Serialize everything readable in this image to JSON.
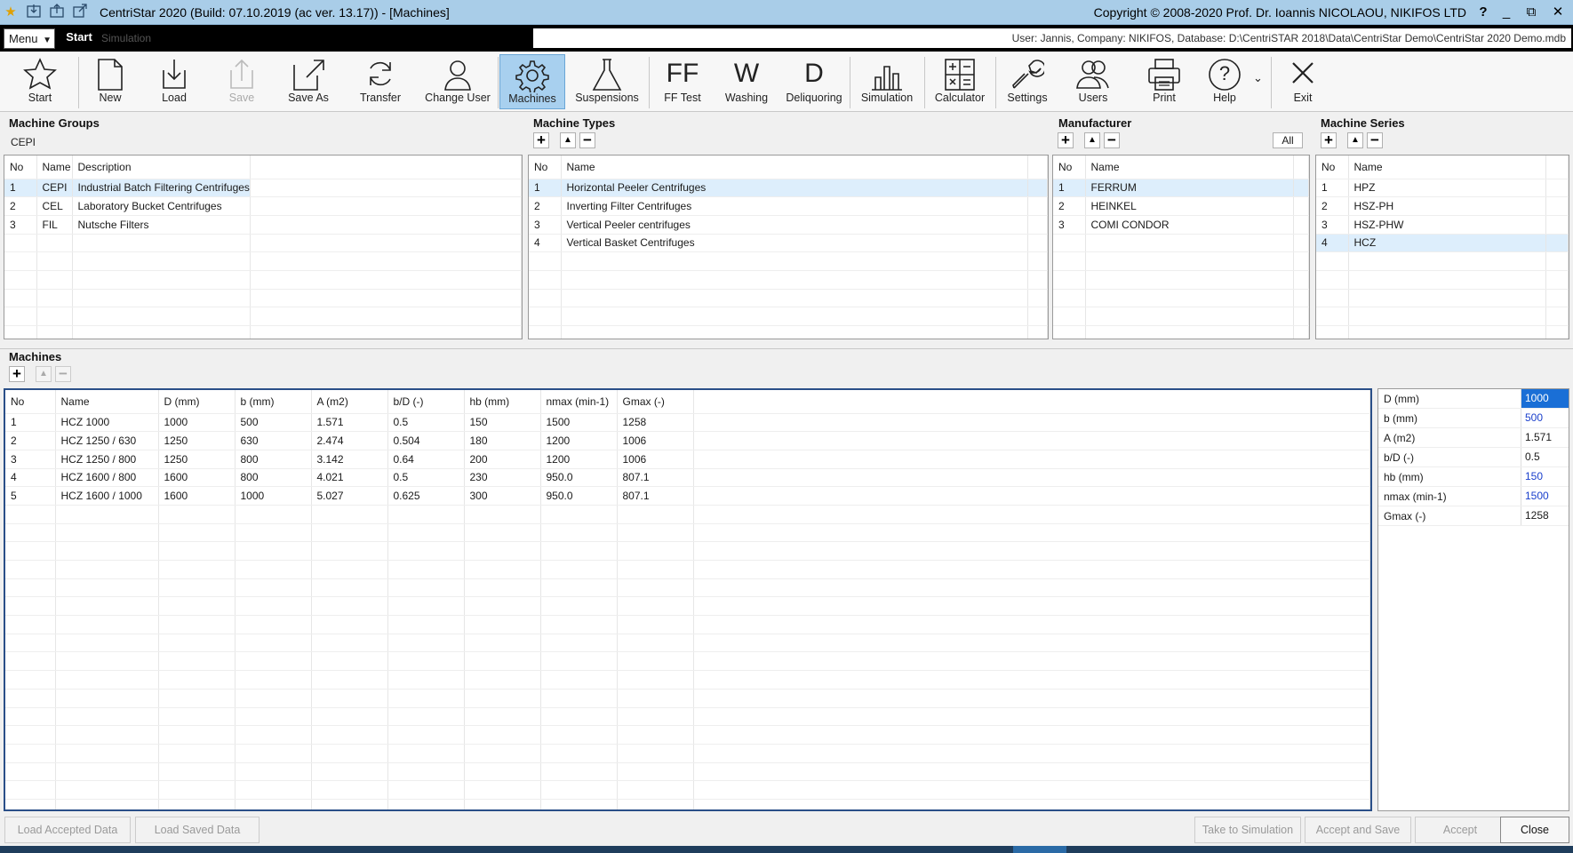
{
  "window": {
    "title": "CentriStar 2020 (Build: 07.10.2019 (ac ver. 13.17)) - [Machines]",
    "copyright": "Copyright © 2008-2020 Prof. Dr. Ioannis NICOLAOU, NIKIFOS LTD",
    "help_btn": "?",
    "minimize_btn": "_",
    "restore_btn": "⧉",
    "close_btn": "✕"
  },
  "menubar": {
    "menu_label": "Menu",
    "tabs": [
      {
        "label": "Start"
      },
      {
        "label": "Simulation"
      }
    ],
    "user_info": "User: Jannis, Company: NIKIFOS, Database: D:\\CentriSTAR 2018\\Data\\CentriStar  Demo\\CentriStar 2020  Demo.mdb"
  },
  "toolbar": {
    "items": [
      {
        "label": "Start"
      },
      {
        "label": "New"
      },
      {
        "label": "Load"
      },
      {
        "label": "Save"
      },
      {
        "label": "Save As"
      },
      {
        "label": "Transfer"
      },
      {
        "label": "Change User"
      },
      {
        "label": "Machines"
      },
      {
        "label": "Suspensions"
      },
      {
        "label": "FF Test",
        "glyph": "FF"
      },
      {
        "label": "Washing",
        "glyph": "W"
      },
      {
        "label": "Deliquoring",
        "glyph": "D"
      },
      {
        "label": "Simulation"
      },
      {
        "label": "Calculator"
      },
      {
        "label": "Settings"
      },
      {
        "label": "Users"
      },
      {
        "label": "Print"
      },
      {
        "label": "Help",
        "glyph": "?"
      },
      {
        "label": "Exit"
      }
    ]
  },
  "machine_groups": {
    "title": "Machine Groups",
    "selected": "CEPI",
    "headers": [
      "No",
      "Name",
      "Description"
    ],
    "rows": [
      [
        "1",
        "CEPI",
        "Industrial Batch Filtering Centrifuges"
      ],
      [
        "2",
        "CEL",
        "Laboratory Bucket Centrifuges"
      ],
      [
        "3",
        "FIL",
        "Nutsche Filters"
      ]
    ]
  },
  "machine_types": {
    "title": "Machine Types",
    "headers": [
      "No",
      "Name"
    ],
    "rows": [
      [
        "1",
        "Horizontal Peeler Centrifuges"
      ],
      [
        "2",
        "Inverting Filter Centrifuges"
      ],
      [
        "3",
        "Vertical Peeler centrifuges"
      ],
      [
        "4",
        "Vertical Basket Centrifuges"
      ]
    ]
  },
  "manufacturer": {
    "title": "Manufacturer",
    "all_label": "All",
    "headers": [
      "No",
      "Name"
    ],
    "rows": [
      [
        "1",
        "FERRUM"
      ],
      [
        "2",
        "HEINKEL"
      ],
      [
        "3",
        "COMI CONDOR"
      ]
    ]
  },
  "machine_series": {
    "title": "Machine Series",
    "headers": [
      "No",
      "Name"
    ],
    "rows": [
      [
        "1",
        "HPZ"
      ],
      [
        "2",
        "HSZ-PH"
      ],
      [
        "3",
        "HSZ-PHW"
      ],
      [
        "4",
        "HCZ"
      ]
    ]
  },
  "machines": {
    "title": "Machines",
    "headers": [
      "No",
      "Name",
      "D (mm)",
      "b (mm)",
      "A (m2)",
      "b/D (-)",
      "hb (mm)",
      "nmax (min-1)",
      "Gmax (-)"
    ],
    "rows": [
      [
        "1",
        "HCZ 1000",
        "1000",
        "500",
        "1.571",
        "0.5",
        "150",
        "1500",
        "1258"
      ],
      [
        "2",
        "HCZ 1250 / 630",
        "1250",
        "630",
        "2.474",
        "0.504",
        "180",
        "1200",
        "1006"
      ],
      [
        "3",
        "HCZ 1250 / 800",
        "1250",
        "800",
        "3.142",
        "0.64",
        "200",
        "1200",
        "1006"
      ],
      [
        "4",
        "HCZ 1600 / 800",
        "1600",
        "800",
        "4.021",
        "0.5",
        "230",
        "950.0",
        "807.1"
      ],
      [
        "5",
        "HCZ 1600 / 1000",
        "1600",
        "1000",
        "5.027",
        "0.625",
        "300",
        "950.0",
        "807.1"
      ]
    ]
  },
  "properties": [
    {
      "name": "D (mm)",
      "value": "1000"
    },
    {
      "name": "b (mm)",
      "value": "500"
    },
    {
      "name": "A (m2)",
      "value": "1.571"
    },
    {
      "name": "b/D (-)",
      "value": "0.5"
    },
    {
      "name": "hb (mm)",
      "value": "150"
    },
    {
      "name": "nmax (min-1)",
      "value": "1500"
    },
    {
      "name": "Gmax (-)",
      "value": "1258"
    }
  ],
  "buttons": {
    "load_accepted": "Load Accepted Data",
    "load_saved": "Load Saved Data",
    "take_to_sim": "Take to Simulation",
    "accept_save": "Accept and Save",
    "accept": "Accept",
    "close": "Close"
  },
  "colors": {
    "accent": "#1a6fd6",
    "selected_row": "#ddeefc",
    "active_tool": "#a8d0ef",
    "titlebar": "#a9cde8"
  }
}
